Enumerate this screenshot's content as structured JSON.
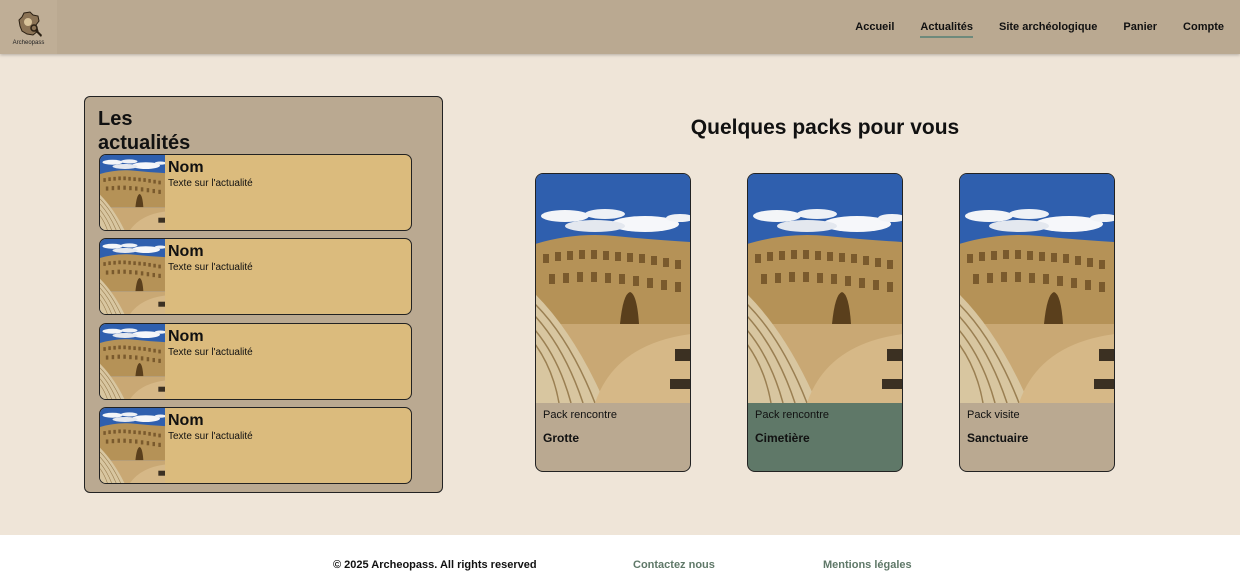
{
  "header": {
    "logo_text": "Archeopass",
    "nav": [
      {
        "label": "Accueil"
      },
      {
        "label": "Actualités",
        "active": true
      },
      {
        "label": "Site archéologique"
      },
      {
        "label": "Panier"
      },
      {
        "label": "Compte"
      }
    ]
  },
  "news": {
    "title": "Les actualités",
    "items": [
      {
        "name": "Nom",
        "text": "Texte sur l'actualité"
      },
      {
        "name": "Nom",
        "text": "Texte sur l'actualité"
      },
      {
        "name": "Nom",
        "text": "Texte sur l'actualité"
      },
      {
        "name": "Nom",
        "text": "Texte sur l'actualité"
      }
    ]
  },
  "packs": {
    "title": "Quelques packs pour vous",
    "items": [
      {
        "type": "Pack rencontre",
        "name": "Grotte"
      },
      {
        "type": "Pack rencontre",
        "name": "Cimetière"
      },
      {
        "type": "Pack visite",
        "name": "Sanctuaire"
      }
    ]
  },
  "footer": {
    "copyright": "© 2025 Archeopass. All rights reserved",
    "contact": "Contactez nous",
    "legal": "Mentions légales"
  },
  "colors": {
    "header_bg": "#baa991",
    "page_bg": "#efe5d8",
    "news_card_bg": "#dbbb7d",
    "accent_green": "#5f7868"
  }
}
